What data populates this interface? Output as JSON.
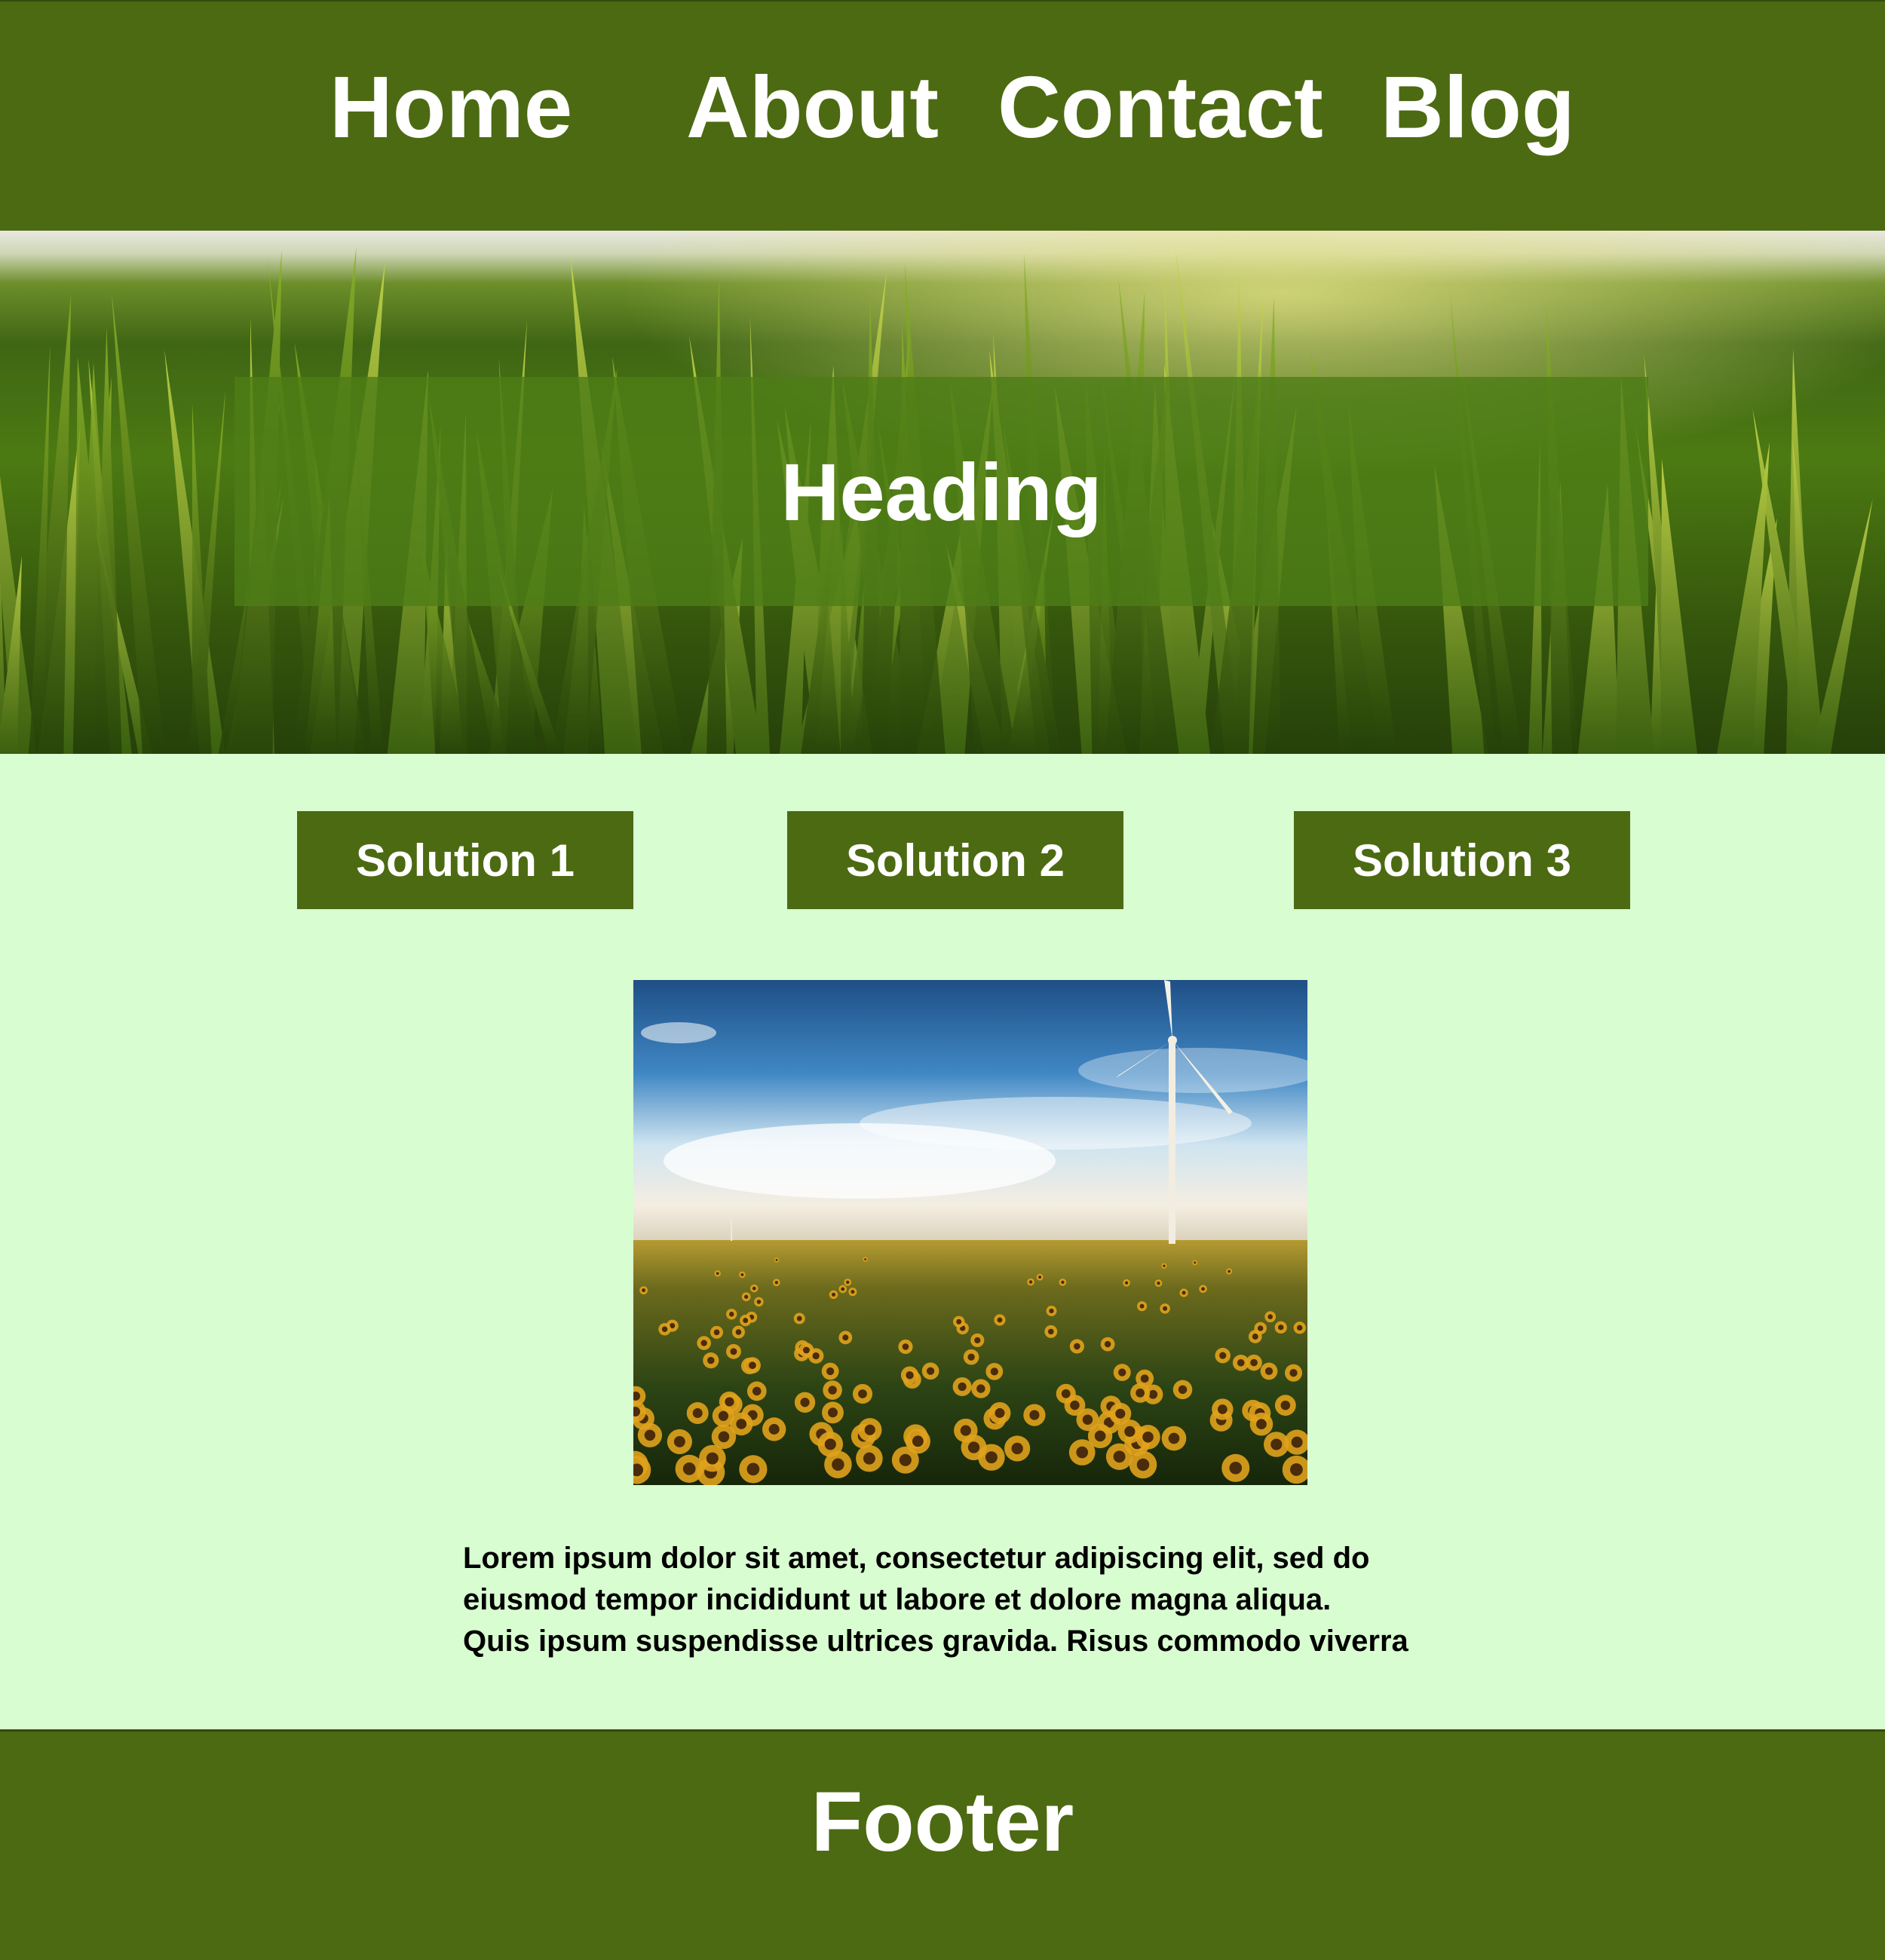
{
  "nav": {
    "items": [
      {
        "label": "Home"
      },
      {
        "label": "About"
      },
      {
        "label": "Contact"
      },
      {
        "label": "Blog"
      }
    ]
  },
  "hero": {
    "heading": "Heading"
  },
  "solutions": [
    {
      "label": "Solution 1"
    },
    {
      "label": "Solution 2"
    },
    {
      "label": "Solution 3"
    }
  ],
  "main": {
    "lorem_lines": [
      "Lorem ipsum dolor sit amet, consectetur adipiscing elit, sed do",
      "eiusmod tempor incididunt ut labore et dolore magna aliqua.",
      "Quis ipsum suspendisse ultrices gravida. Risus commodo viverra"
    ]
  },
  "footer": {
    "label": "Footer"
  },
  "colors": {
    "primary_green": "#4c6a12",
    "page_background": "#d8fdd0",
    "hero_panel": "#4d7d16",
    "text_light": "#ffffff",
    "text_dark": "#000000"
  }
}
